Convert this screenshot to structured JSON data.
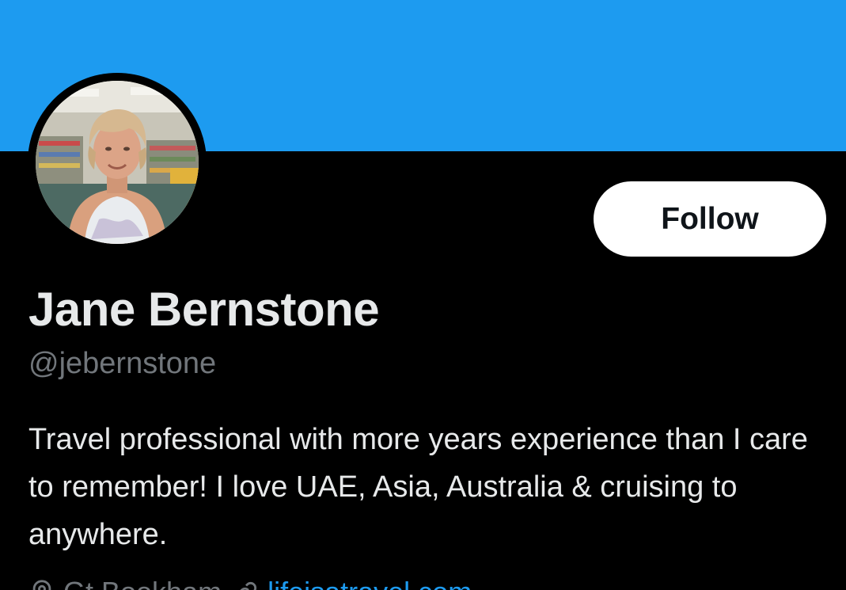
{
  "profile": {
    "banner_color": "#1d9bf0",
    "avatar_icon": "profile-photo",
    "display_name": "Jane Bernstone",
    "handle": "@jebernstone",
    "bio": "Travel professional with more years experience than I care to remember! I love UAE, Asia, Australia & cruising to anywhere.",
    "follow_label": "Follow"
  },
  "meta": {
    "location_icon": "location-pin-icon",
    "location": "Gt Bookham",
    "link_icon": "link-icon",
    "link_text": "lifeisatravel.com"
  },
  "colors": {
    "background": "#000000",
    "text_primary": "#e7e9ea",
    "text_secondary": "#71767b",
    "accent": "#1d9bf0",
    "button_bg": "#ffffff",
    "button_text": "#0f1419"
  }
}
